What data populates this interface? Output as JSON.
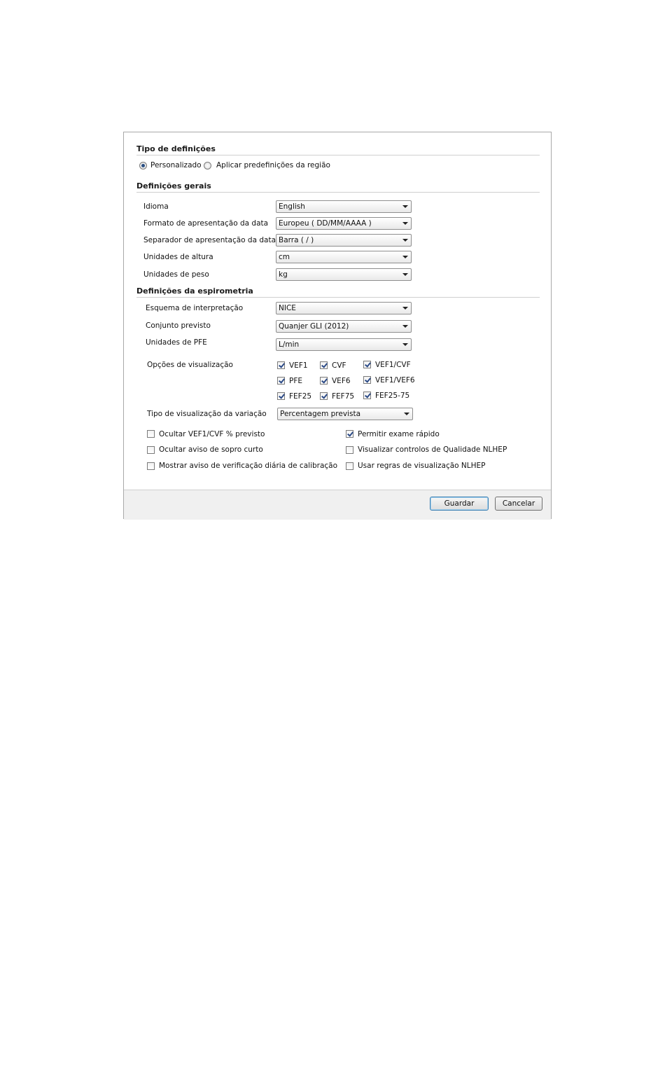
{
  "settings_type": {
    "title": "Tipo de definições",
    "options": [
      {
        "label": "Personalizado",
        "selected": true
      },
      {
        "label": "Aplicar predefinições da região",
        "selected": false
      }
    ]
  },
  "general": {
    "title": "Definições gerais",
    "rows": [
      {
        "label": "Idioma",
        "value": "English"
      },
      {
        "label": "Formato de apresentação da data",
        "value": "Europeu ( DD/MM/AAAA )"
      },
      {
        "label": "Separador de apresentação da data",
        "value": "Barra ( / )"
      },
      {
        "label": "Unidades de altura",
        "value": "cm"
      },
      {
        "label": "Unidades de peso",
        "value": "kg"
      }
    ]
  },
  "spirometry": {
    "title": "Definições da espirometria",
    "rows": [
      {
        "label": "Esquema de interpretação",
        "value": "NICE"
      },
      {
        "label": "Conjunto previsto",
        "value": "Quanjer GLI (2012)"
      },
      {
        "label": "Unidades de PFE",
        "value": "L/min"
      }
    ],
    "display_options_label": "Opções de visualização",
    "display_options": [
      {
        "label": "VEF1",
        "checked": true
      },
      {
        "label": "CVF",
        "checked": true
      },
      {
        "label": "VEF1/CVF",
        "checked": true
      },
      {
        "label": "PFE",
        "checked": true
      },
      {
        "label": "VEF6",
        "checked": true
      },
      {
        "label": "VEF1/VEF6",
        "checked": true
      },
      {
        "label": "FEF25",
        "checked": true
      },
      {
        "label": "FEF75",
        "checked": true
      },
      {
        "label": "FEF25-75",
        "checked": true
      }
    ],
    "variation_label": "Tipo de visualização da variação",
    "variation_value": "Percentagem prevista",
    "flags": [
      {
        "label": "Ocultar VEF1/CVF % previsto",
        "checked": false
      },
      {
        "label": "Permitir exame rápido",
        "checked": true
      },
      {
        "label": "Ocultar aviso de sopro curto",
        "checked": false
      },
      {
        "label": "Visualizar controlos de Qualidade NLHEP",
        "checked": false
      },
      {
        "label": "Mostrar aviso de verificação diária de calibração",
        "checked": false
      },
      {
        "label": "Usar regras de visualização NLHEP",
        "checked": false
      }
    ]
  },
  "footer": {
    "save_label": "Guardar",
    "cancel_label": "Cancelar"
  }
}
